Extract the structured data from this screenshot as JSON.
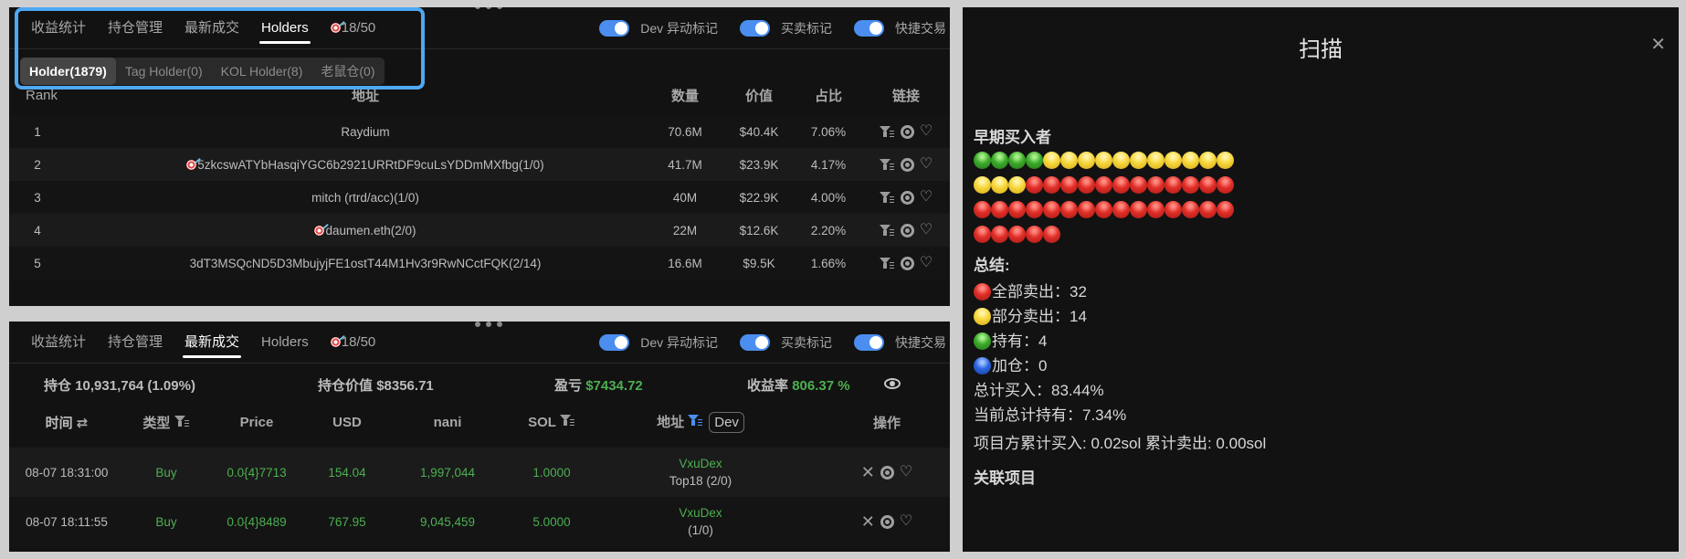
{
  "tabs": [
    {
      "label": "收益统计"
    },
    {
      "label": "持仓管理"
    },
    {
      "label": "最新成交"
    },
    {
      "label": "Holders"
    },
    {
      "label": "18/50",
      "icon": "target-icon"
    }
  ],
  "toggles": [
    {
      "label": "Dev 异动标记",
      "on": true
    },
    {
      "label": "买卖标记",
      "on": true
    },
    {
      "label": "快捷交易",
      "on": true
    }
  ],
  "holders_panel": {
    "active_tab": "Holders",
    "subtabs": [
      {
        "label": "Holder(1879)",
        "active": true
      },
      {
        "label": "Tag Holder(0)"
      },
      {
        "label": "KOL Holder(8)"
      },
      {
        "label": "老鼠仓(0)"
      }
    ],
    "columns": {
      "rank": "Rank",
      "address": "地址",
      "quantity": "数量",
      "value": "价值",
      "share": "占比",
      "links": "链接"
    },
    "rows": [
      {
        "rank": "1",
        "address": "Raydium",
        "target": false,
        "quantity": "70.6M",
        "value": "$40.4K",
        "share": "7.06%"
      },
      {
        "rank": "2",
        "address": "5zkcswATYbHasqiYGC6b2921URRtDF9cuLsYDDmMXfbg(1/0)",
        "target": true,
        "quantity": "41.7M",
        "value": "$23.9K",
        "share": "4.17%"
      },
      {
        "rank": "3",
        "address": "mitch (rtrd/acc)(1/0)",
        "target": false,
        "quantity": "40M",
        "value": "$22.9K",
        "share": "4.00%"
      },
      {
        "rank": "4",
        "address": "daumen.eth(2/0)",
        "target": true,
        "quantity": "22M",
        "value": "$12.6K",
        "share": "2.20%"
      },
      {
        "rank": "5",
        "address": "3dT3MSQcND5D3MbujyjFE1ostT44M1Hv3r9RwNCctFQK(2/14)",
        "target": false,
        "quantity": "16.6M",
        "value": "$9.5K",
        "share": "1.66%"
      }
    ],
    "row_icons": [
      "filter-icon",
      "at-icon",
      "heart-icon"
    ]
  },
  "trades_panel": {
    "active_tab": "最新成交",
    "stats": {
      "position_label": "持仓",
      "position_value": "10,931,764 (1.09%)",
      "position_worth_label": "持仓价值",
      "position_worth_value": "$8356.71",
      "pnl_label": "盈亏",
      "pnl_value": "$7434.72",
      "roi_label": "收益率",
      "roi_value": "806.37 %"
    },
    "columns": {
      "time": "时间",
      "type": "类型",
      "price": "Price",
      "usd": "USD",
      "token": "nani",
      "sol": "SOL",
      "address": "地址",
      "dev_chip": "Dev",
      "ops": "操作"
    },
    "rows": [
      {
        "time": "08-07 18:31:00",
        "type": "Buy",
        "price": "0.0{4}7713",
        "usd": "154.04",
        "token": "1,997,044",
        "sol": "1.0000",
        "address": "VxuDex",
        "address_sub": "Top18 (2/0)"
      },
      {
        "time": "08-07 18:11:55",
        "type": "Buy",
        "price": "0.0{4}8489",
        "usd": "767.95",
        "token": "9,045,459",
        "sol": "5.0000",
        "address": "VxuDex",
        "address_sub": "(1/0)"
      }
    ],
    "row_icons": [
      "close-icon",
      "at-icon",
      "heart-icon"
    ]
  },
  "scan_panel": {
    "title": "扫描",
    "early_buyers_title": "早期买入者",
    "early_buyers": {
      "green": 4,
      "yellow": 14,
      "red": 32,
      "order": [
        "green",
        "yellow",
        "red"
      ]
    },
    "summary_title": "总结:",
    "summary": {
      "all_sold": "全部卖出：32",
      "partial_sold": "部分卖出：14",
      "holding": "持有：4",
      "added": "加仓：0",
      "total_bought": "总计买入：83.44%",
      "current_holding": "当前总计持有：7.34%"
    },
    "project_line": "项目方累计买入: 0.02sol 累计卖出: 0.00sol",
    "related_title": "关联项目"
  },
  "colors": {
    "accent": "#4b8ef0",
    "highlight": "#4ea9f2",
    "positive": "#4caf50",
    "panel_bg": "#121212"
  }
}
